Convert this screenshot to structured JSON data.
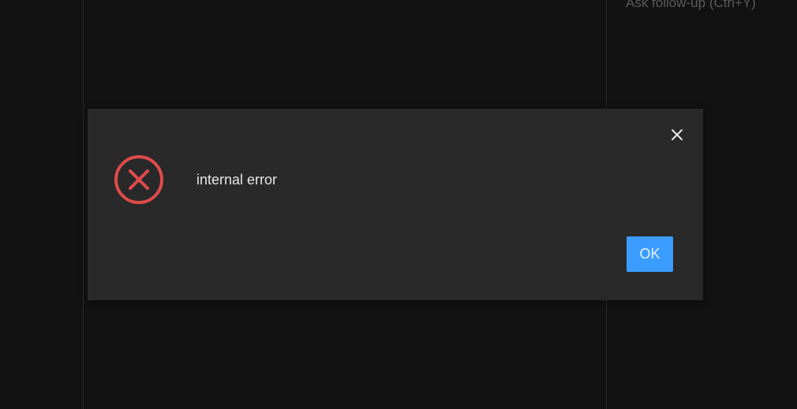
{
  "background": {
    "followup_hint": "Ask follow-up (Ctrl+Y)"
  },
  "dialog": {
    "message": "internal error",
    "ok_label": "OK",
    "icons": {
      "status": "error-x-circle-icon",
      "close": "close-icon"
    },
    "colors": {
      "error": "#e04b4b",
      "primary_button": "#3b9cff",
      "surface": "#292929",
      "backdrop": "#121212"
    }
  }
}
